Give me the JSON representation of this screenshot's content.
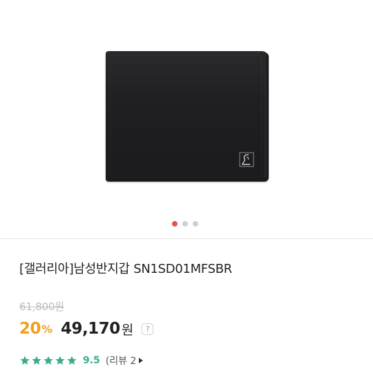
{
  "gallery": {
    "image_alt": "black bifold leather wallet",
    "dots": [
      {
        "active": true
      },
      {
        "active": false
      },
      {
        "active": false
      }
    ]
  },
  "product": {
    "title": "[갤러리아]남성반지갑 SN1SD01MFSBR",
    "original_price": "61,800원",
    "discount": "20",
    "percent_sign": "%",
    "price": "49,170",
    "currency": "원",
    "help_label": "?"
  },
  "rating": {
    "value": "9.5",
    "stars": 5,
    "review_label": "(리뷰 2"
  },
  "colors": {
    "discount": "#f0a01c",
    "rating": "#3aab8f",
    "active_dot": "#e8504d"
  }
}
